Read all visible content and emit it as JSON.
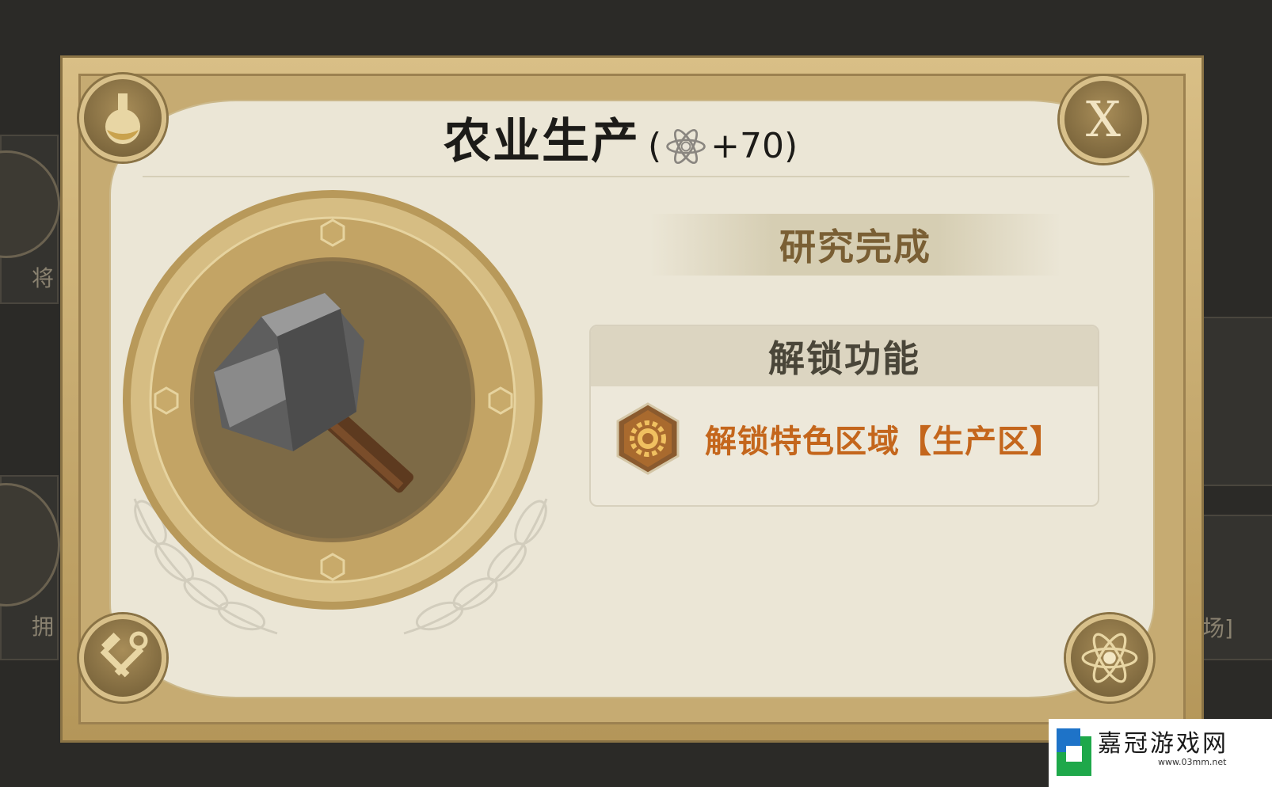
{
  "dialog": {
    "title": "农业生产",
    "bonus_open": "(",
    "bonus_value": "+70",
    "bonus_close": ")",
    "bonus_icon": "atom-icon",
    "status": "研究完成",
    "unlock_heading": "解锁功能",
    "unlock_item": "解锁特色区域【生产区】",
    "unlock_item_icon": "gear-icon",
    "close_label": "X",
    "medal_icon": "hammer-icon",
    "corner_icons": [
      "flask-icon",
      "close-icon",
      "tools-icon",
      "atom-icon"
    ]
  },
  "background": {
    "left_labels": [
      "将",
      "拥"
    ],
    "right_label": "矿场]"
  },
  "watermark": {
    "name": "嘉冠游戏网",
    "url": "www.03mm.net"
  },
  "colors": {
    "frame": "#c6ab72",
    "paper": "#ebe6d6",
    "accent_orange": "#c4661c",
    "status_brown": "#7a5f34"
  }
}
